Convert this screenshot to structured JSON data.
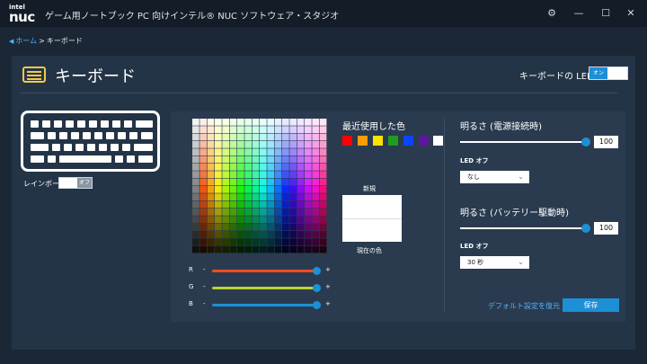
{
  "app": {
    "logo_top": "intel",
    "logo_main": "nuc",
    "title": "ゲーム用ノートブック PC 向けインテル® NUC ソフトウェア・スタジオ"
  },
  "window_controls": [
    "gear-icon",
    "minimize-icon",
    "maximize-icon",
    "close-icon"
  ],
  "breadcrumb": {
    "home": "ホーム",
    "separator": ">",
    "current": "キーボード"
  },
  "page": {
    "title": "キーボード",
    "led_label": "キーボードの LED",
    "led_toggle": "オン",
    "rainbow_label": "レインボー",
    "rainbow_toggle": "オフ"
  },
  "color": {
    "recent_title": "最近使用した色",
    "recent_colors": [
      "#ff0000",
      "#ff9c00",
      "#ffe100",
      "#1f9d1f",
      "#0d45ff",
      "#5d16a0",
      "#ffffff"
    ],
    "new_label": "新規",
    "current_label": "現在の色",
    "sliders": [
      {
        "label": "R",
        "minus": "-",
        "plus": "+",
        "color": "#ff4b1f",
        "value": 255
      },
      {
        "label": "G",
        "minus": "-",
        "plus": "+",
        "color": "#b7d531",
        "value": 255
      },
      {
        "label": "B",
        "minus": "-",
        "plus": "+",
        "color": "#1d8fd6",
        "value": 255
      }
    ]
  },
  "brightness": {
    "plugged_title": "明るさ (電源接続時)",
    "plugged_value": "100",
    "plugged_led_off_label": "LED オフ",
    "plugged_led_off_value": "なし",
    "battery_title": "明るさ (バッテリー駆動時)",
    "battery_value": "100",
    "battery_led_off_label": "LED オフ",
    "battery_led_off_value": "30 秒"
  },
  "actions": {
    "restore_defaults": "デフォルト設定を復元",
    "save": "保存"
  },
  "colors": {
    "accent": "#1d8fd6",
    "link": "#4fb3ff",
    "title_icon": "#f1c94a",
    "background": "#1b2735",
    "panel": "#243447"
  }
}
